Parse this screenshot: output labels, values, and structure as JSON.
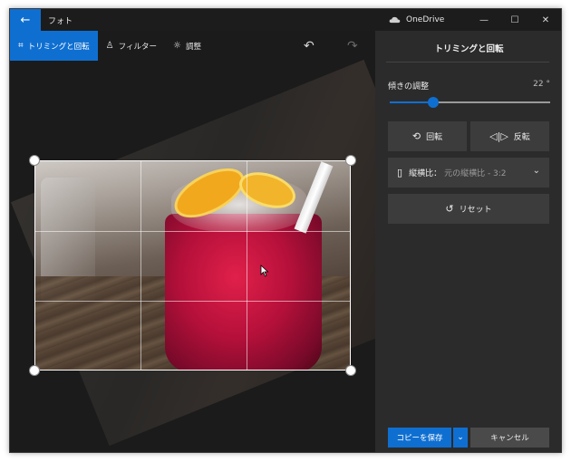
{
  "window": {
    "app_title": "フォト",
    "onedrive_label": "OneDrive",
    "controls": {
      "minimize": "—",
      "maximize": "☐",
      "close": "✕"
    }
  },
  "toolbar": {
    "crop_rotate": "トリミングと回転",
    "filter": "フィルター",
    "adjust": "調整"
  },
  "panel": {
    "title": "トリミングと回転",
    "tilt_label": "傾きの調整",
    "tilt_value": "22 °",
    "tilt_fraction": 0.27,
    "rotate_button": "回転",
    "flip_button": "反転",
    "aspect_label": "縦横比：",
    "aspect_value": "元の縦横比 - 3:2",
    "reset_button": "リセット",
    "save_copy_button": "コピーを保存",
    "cancel_button": "キャンセル"
  },
  "colors": {
    "accent": "#0f6fd1",
    "panel_bg": "#2b2b2b",
    "button_bg": "#3c3c3c"
  }
}
